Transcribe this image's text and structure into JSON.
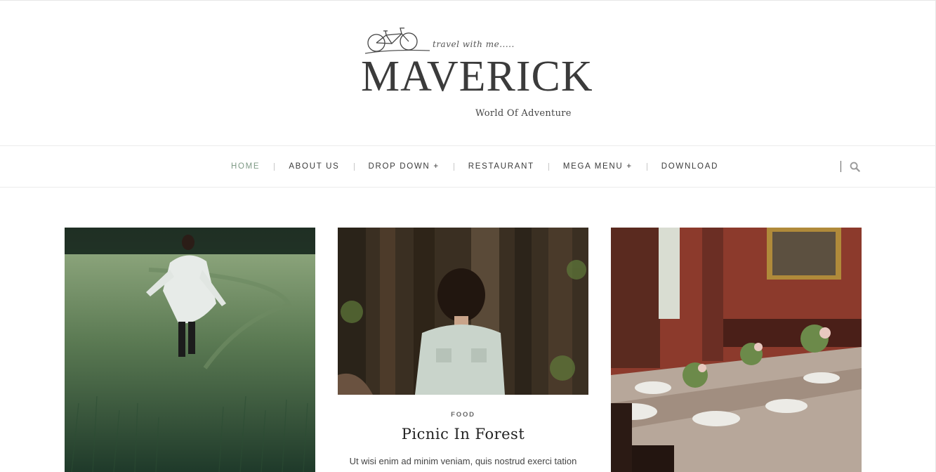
{
  "header": {
    "tagline": "travel with me.....",
    "brand": "MAVERICK",
    "subtitle": "World Of Adventure"
  },
  "nav": {
    "items": [
      {
        "label": "HOME",
        "active": true
      },
      {
        "label": "ABOUT US",
        "active": false
      },
      {
        "label": "DROP DOWN +",
        "active": false
      },
      {
        "label": "RESTAURANT",
        "active": false
      },
      {
        "label": "MEGA MENU +",
        "active": false
      },
      {
        "label": "DOWNLOAD",
        "active": false
      }
    ],
    "search_icon": "search-icon"
  },
  "posts": [
    {
      "image": "woman-walking-in-wheat-field"
    },
    {
      "image": "woman-in-forest",
      "category": "FOOD",
      "title": "Picnic In Forest",
      "excerpt": "Ut wisi enim ad minim veniam, quis nostrud exerci tation"
    },
    {
      "image": "dining-table-with-flowers"
    }
  ],
  "colors": {
    "accent": "#7f9a86",
    "text": "#3a3a3a",
    "border": "#ececec"
  }
}
